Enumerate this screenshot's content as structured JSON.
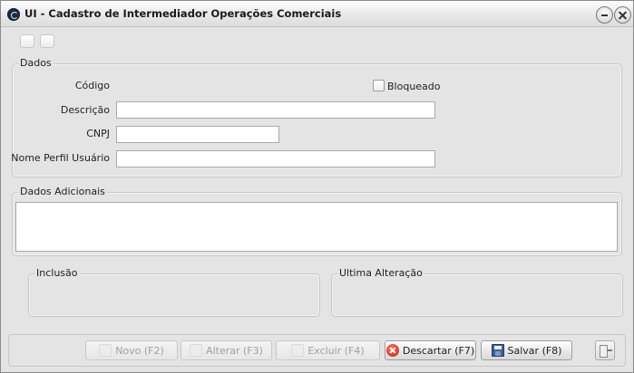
{
  "window": {
    "title": "UI - Cadastro de Intermediador Operações Comerciais"
  },
  "dados": {
    "group_label": "Dados",
    "codigo_label": "Código",
    "codigo_value": "",
    "bloqueado_label": "Bloqueado",
    "bloqueado_checked": false,
    "descricao_label": "Descrição",
    "descricao_value": "",
    "cnpj_label": "CNPJ",
    "cnpj_value": "",
    "perfil_label": "Nome Perfil Usuário",
    "perfil_value": ""
  },
  "adicionais": {
    "group_label": "Dados Adicionais",
    "value": ""
  },
  "inclusao": {
    "group_label": "Inclusão"
  },
  "ultima_alteracao": {
    "group_label": "Ultima Alteração"
  },
  "actions": {
    "novo_label": "Novo (F2)",
    "alterar_label": "Alterar (F3)",
    "excluir_label": "Excluir (F4)",
    "descartar_label": "Descartar (F7)",
    "salvar_label": "Salvar (F8)"
  },
  "icons": {
    "app": "app-logo-icon",
    "minimize": "minimize-icon",
    "close": "close-icon",
    "descartar": "cancel-icon",
    "salvar": "save-icon",
    "sair": "exit-icon"
  },
  "colors": {
    "window_bg": "#e4e4e4",
    "cancel_red": "#c8140e",
    "save_blue": "#3f5e95"
  }
}
